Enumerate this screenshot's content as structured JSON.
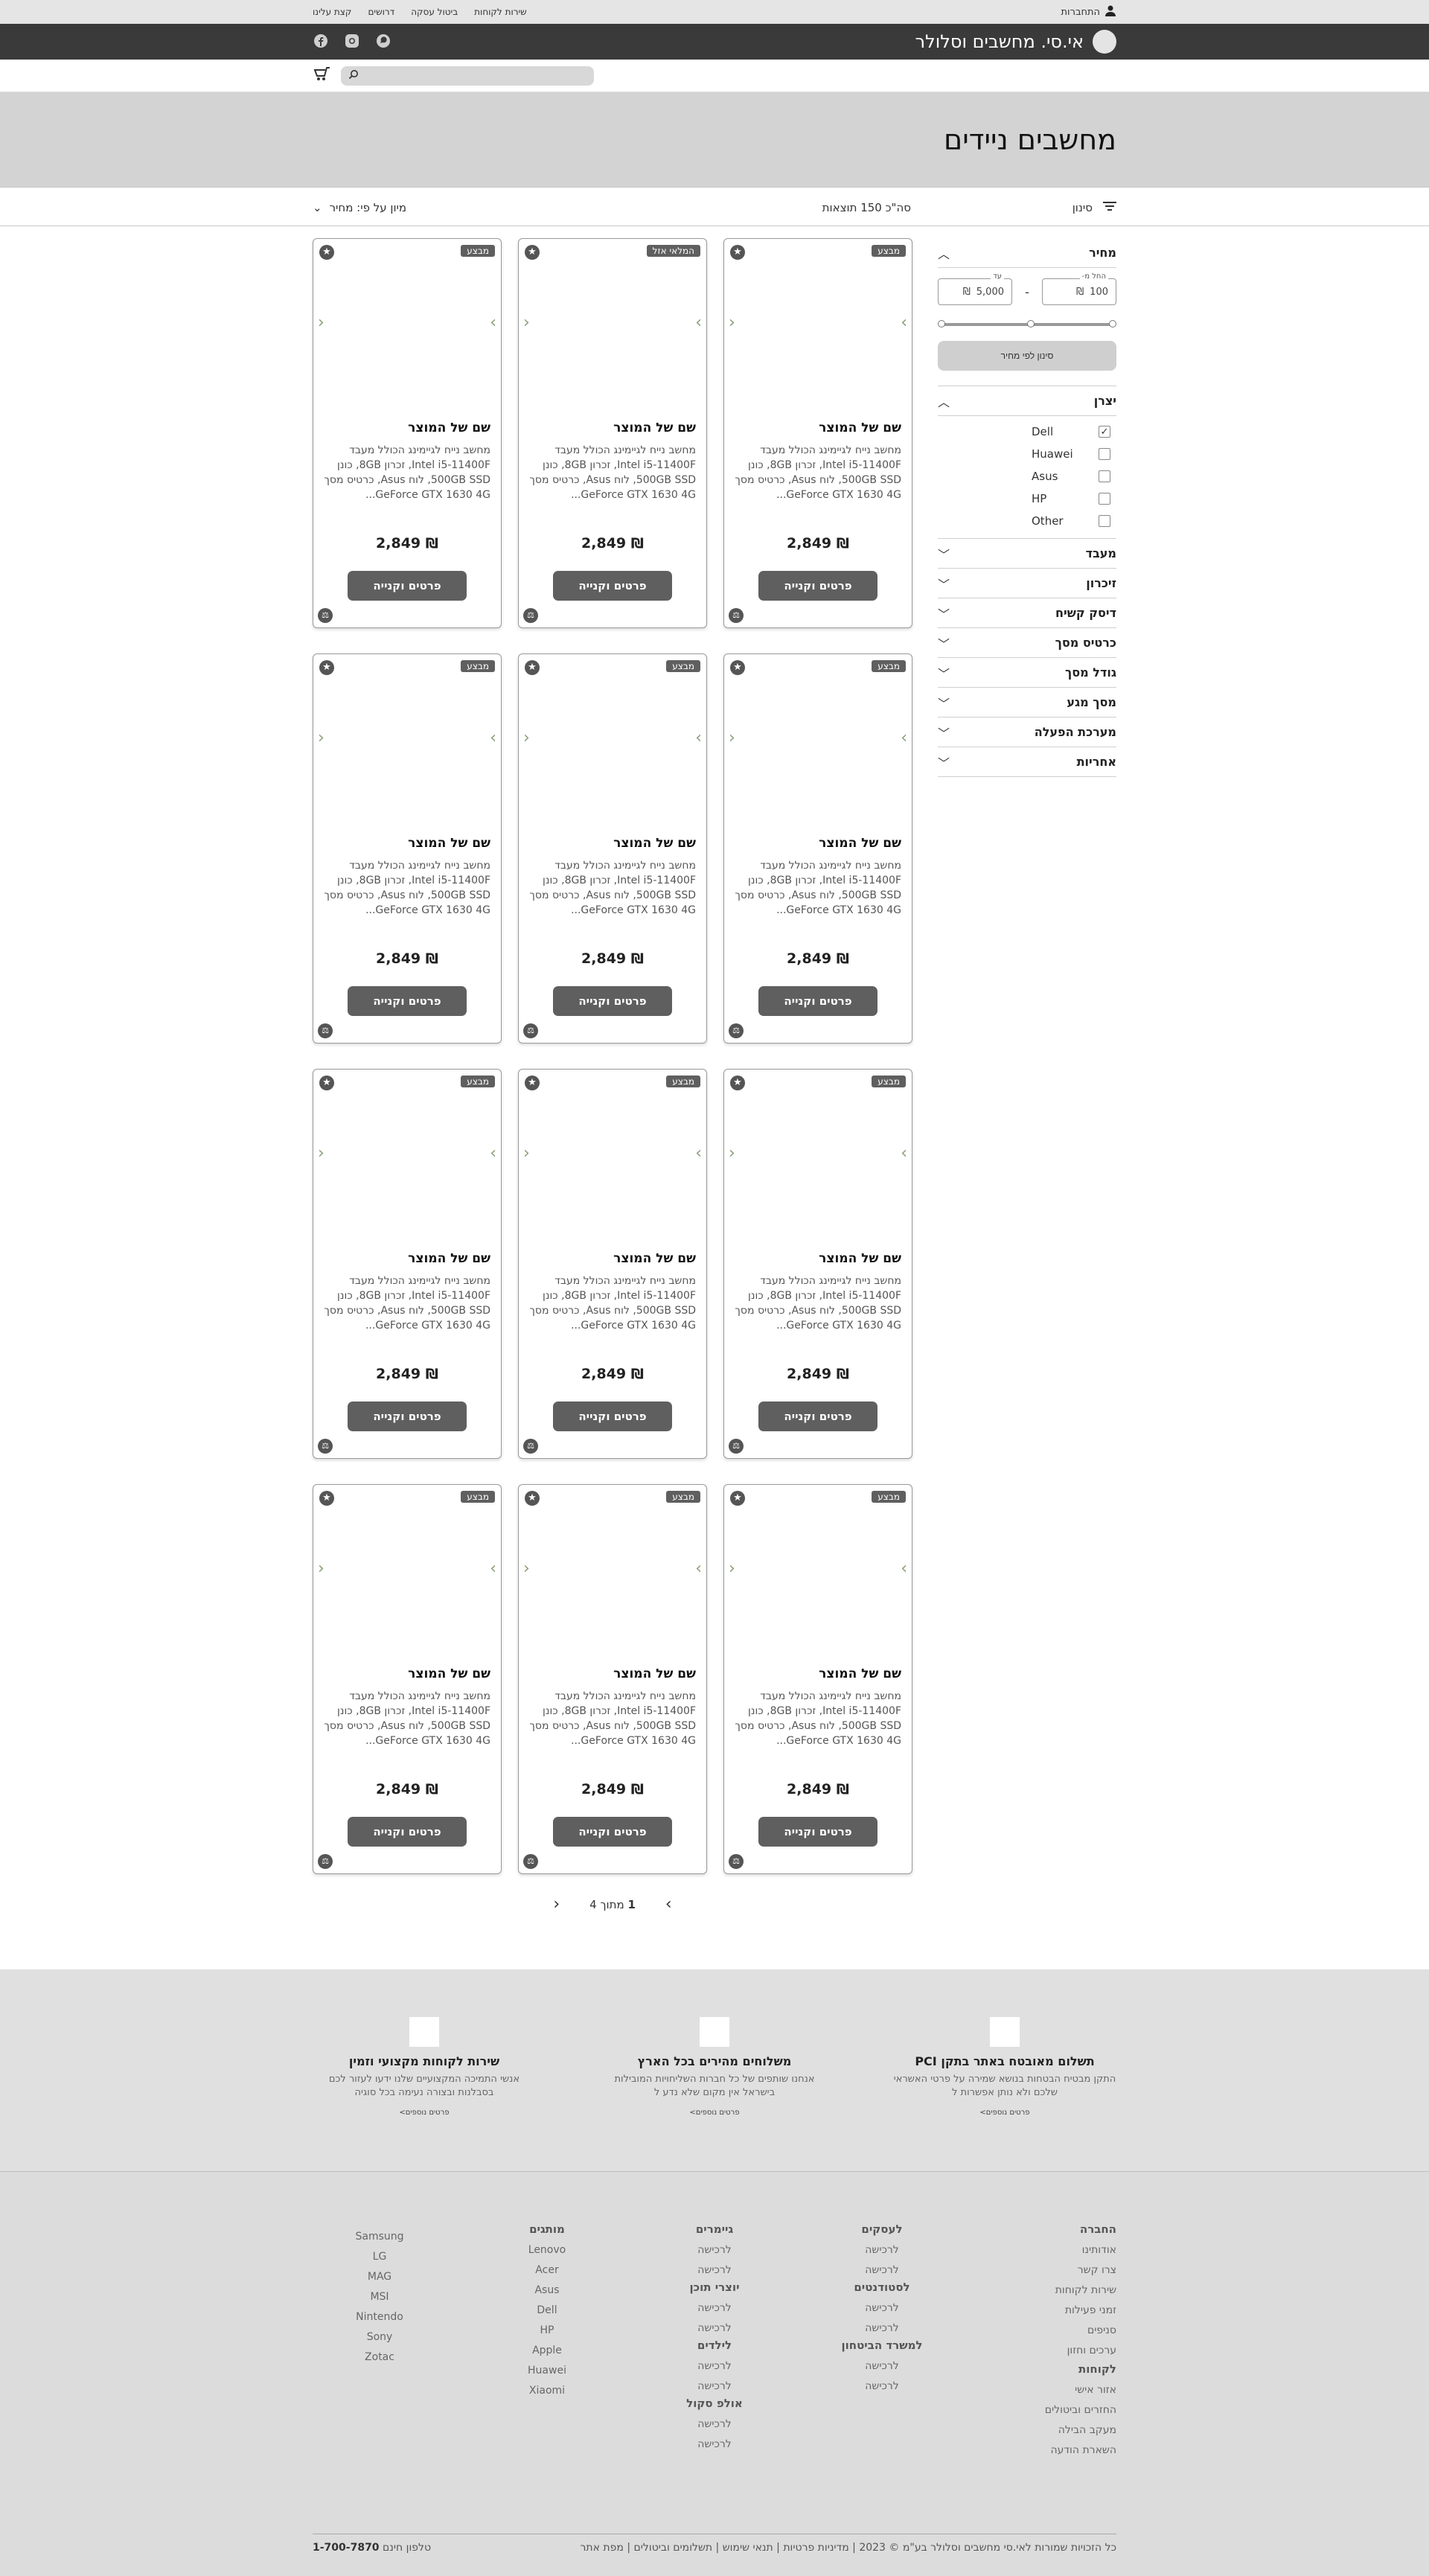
{
  "topbar": {
    "login": "התחברות",
    "links": [
      "שירות לקוחות",
      "ביטול עסקה",
      "דרושים",
      "קצת עלינו"
    ]
  },
  "header": {
    "brand": "אי.סי. מחשבים וסלולר",
    "social": [
      "whatsapp-icon",
      "instagram-icon",
      "facebook-icon"
    ]
  },
  "search": {
    "placeholder": ""
  },
  "page": {
    "title": "מחשבים ניידים"
  },
  "filterbar": {
    "filter_label": "סינון",
    "results": "סה\"כ 150 תוצאות",
    "sort_label": "מיון על פי: מחיר"
  },
  "sidebar": {
    "price": {
      "title": "מחיר",
      "from_caption": "החל מ-",
      "from_value": "100",
      "to_caption": "עד",
      "to_value": "5,000",
      "currency": "₪",
      "button": "סינון לפי מחיר"
    },
    "brands": {
      "title": "יצרן",
      "items": [
        {
          "label": "Dell",
          "checked": true
        },
        {
          "label": "Huawei",
          "checked": false
        },
        {
          "label": "Asus",
          "checked": false
        },
        {
          "label": "HP",
          "checked": false
        },
        {
          "label": "Other",
          "checked": false
        }
      ]
    },
    "collapsed": [
      "מעבד",
      "זיכרון",
      "דיסק קשיח",
      "כרטיס מסך",
      "גודל מסך",
      "מסך מגע",
      "מערכת הפעלה",
      "אחריות"
    ]
  },
  "products": [
    {
      "badge": "מבצע"
    },
    {
      "badge": "המלאי אזל"
    },
    {
      "badge": "מבצע"
    },
    {
      "badge": "מבצע"
    },
    {
      "badge": "מבצע"
    },
    {
      "badge": "מבצע"
    },
    {
      "badge": "מבצע"
    },
    {
      "badge": "מבצע"
    },
    {
      "badge": "מבצע"
    },
    {
      "badge": "מבצע"
    },
    {
      "badge": "מבצע"
    },
    {
      "badge": "מבצע"
    }
  ],
  "product_template": {
    "title": "שם של המוצר",
    "desc": "מחשב נייח לגיימינג הכולל מעבד Intel i5-11400F, זכרון 8GB, כונן 500GB SSD, לוח Asus, כרטיס מסך GeForce GTX 1630 4G...",
    "price": "₪ 2,849",
    "button": "פרטים וקנייה"
  },
  "pagination": {
    "current": "1",
    "text": "מתוך 4"
  },
  "features": [
    {
      "title": "תשלום מאובטח באתר בתקן PCI",
      "desc": "התקן מבטיח הבטחות בנושא שמירה על פרטי האשראי שלכם ולא נותן אפשרות ל",
      "more": "פרטים נוספים>"
    },
    {
      "title": "משלוחים מהירים בכל הארץ",
      "desc": "אנחנו שותפים של כל חברות השליחויות המובילות בישראל אין מקום שלא נדע ל",
      "more": "פרטים נוספים>"
    },
    {
      "title": "שירות לקוחות מקצועי וזמין",
      "desc": "אנשי התמיכה המקצועיים שלנו ידעו לעזור לכם בסבלנות ובצורה נעימה בכל סוגיה",
      "more": "פרטים נוספים>"
    }
  ],
  "footer": {
    "col1": {
      "title": "החברה",
      "items": [
        "אודותינו",
        "צרו קשר",
        "שירות לקוחות",
        "זמני פעילות",
        "סניפים",
        "ערכים וחזון"
      ],
      "title2": "לקוחות",
      "items2": [
        "אזור אישי",
        "החזרים וביטולים",
        "מעקב הבילה",
        "השארת הודעה"
      ]
    },
    "col2": {
      "title": "לעסקים",
      "items": [
        "לרכישה",
        "לרכישה"
      ],
      "title2": "לסטודנטים",
      "items2": [
        "לרכישה",
        "לרכישה"
      ],
      "title3": "למשרד הביטחון",
      "items3": [
        "לרכישה",
        "לרכישה"
      ]
    },
    "col3": {
      "title": "גיימרים",
      "items": [
        "לרכישה",
        "לרכישה"
      ],
      "title2": "יוצרי תוכן",
      "items2": [
        "לרכישה",
        "לרכישה"
      ],
      "title3": "לילדים",
      "items3": [
        "לרכישה",
        "לרכישה"
      ],
      "title4": "אולפ סקול",
      "items4": [
        "לרכישה",
        "לרכישה"
      ]
    },
    "col4": {
      "title": "מותגים",
      "items": [
        "Lenovo",
        "Acer",
        "Asus",
        "Dell",
        "HP",
        "Apple",
        "Huawei",
        "Xiaomi"
      ]
    },
    "col5": {
      "items": [
        "Samsung",
        "LG",
        "MAG",
        "MSI",
        "Nintendo",
        "Sony",
        "Zotac"
      ]
    },
    "copyright": "כל הזכויות שמורות לאי.סי מחשבים וסלולר בע\"מ © 2023 | מדיניות פרטיות | תנאי שימוש | תשלומים וביטולים | מפת אתר",
    "phone_label": "טלפון חינם",
    "phone": "1-700-7870"
  }
}
